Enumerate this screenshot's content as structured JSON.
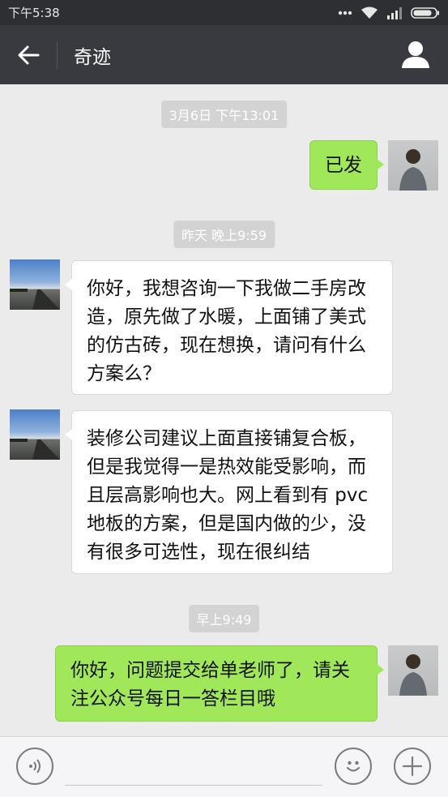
{
  "status_bar": {
    "time": "下午5:38"
  },
  "header": {
    "title": "奇迹"
  },
  "messages": [
    {
      "type": "time",
      "text": "3月6日 下午13:01"
    },
    {
      "type": "msg",
      "side": "right",
      "text": "已发"
    },
    {
      "type": "time",
      "text": "昨天 晚上9:59"
    },
    {
      "type": "msg",
      "side": "left",
      "lines": [
        "你好，我想咨询一下我做二手房改",
        "造，原先做了水暖，上面铺了美式",
        "的仿古砖，现在想换，请问有什么",
        "方案么？"
      ]
    },
    {
      "type": "msg",
      "side": "left",
      "lines": [
        "装修公司建议上面直接铺复合板，",
        "但是我觉得一是热效能受影响，而",
        "且层高影响也大。网上看到有 pvc",
        "地板的方案，但是国内做的少，没",
        "有很多可选性，现在很纠结"
      ]
    },
    {
      "type": "time",
      "text": "早上9:49"
    },
    {
      "type": "msg",
      "side": "right",
      "lines": [
        "你好，问题提交给单老师了，请关",
        "注公众号每日一答栏目哦"
      ]
    }
  ],
  "input_bar": {
    "text": ""
  },
  "colors": {
    "header_bg": "#393a3f",
    "bubble_sent": "#a0e75a",
    "bubble_received": "#ffffff",
    "chat_bg": "#ebebeb"
  }
}
